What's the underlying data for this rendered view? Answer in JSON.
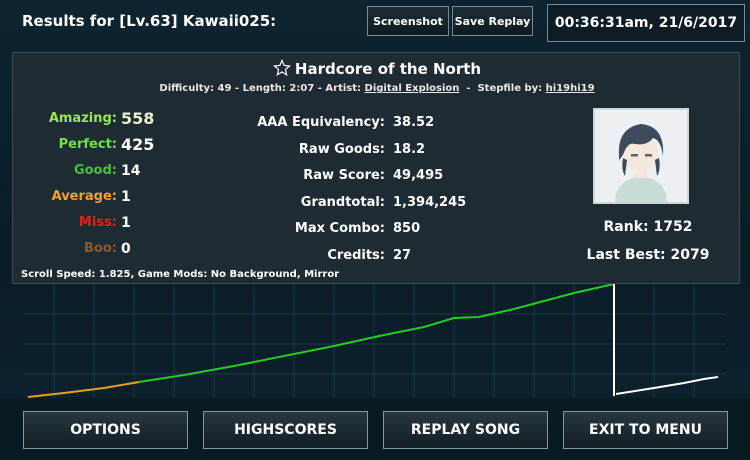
{
  "header": {
    "results_title": "Results for [Lv.63] Kawaii025:",
    "screenshot_label": "Screenshot",
    "save_replay_label": "Save Replay",
    "timestamp": "00:36:31am, 21/6/2017"
  },
  "song": {
    "title": "Hardcore of the North",
    "difficulty_label": "Difficulty:",
    "difficulty": "49",
    "length_label": "Length:",
    "length": "2:07",
    "artist_label": "Artist:",
    "artist": "Digital Explosion",
    "stepfile_label": "Stepfile by:",
    "stepfile_by": "hi19hi19"
  },
  "judgements": [
    {
      "label": "Amazing:",
      "value": "558",
      "color": "#9ae64e"
    },
    {
      "label": "Perfect:",
      "value": "425",
      "color": "#6ee04a"
    },
    {
      "label": "Good:",
      "value": "14",
      "color": "#45c236"
    },
    {
      "label": "Average:",
      "value": "1",
      "color": "#f0a12a"
    },
    {
      "label": "Miss:",
      "value": "1",
      "color": "#e8201c"
    },
    {
      "label": "Boo:",
      "value": "0",
      "color": "#8a5a2a"
    }
  ],
  "stats": [
    {
      "label": "AAA Equivalency:",
      "value": "38.52"
    },
    {
      "label": "Raw Goods:",
      "value": "18.2"
    },
    {
      "label": "Raw Score:",
      "value": "49,495"
    },
    {
      "label": "Grandtotal:",
      "value": "1,394,245"
    },
    {
      "label": "Max Combo:",
      "value": "850"
    },
    {
      "label": "Credits:",
      "value": "27"
    }
  ],
  "player": {
    "rank": "Rank: 1752",
    "last_best": "Last Best: 2079"
  },
  "mods": "Scroll Speed: 1.825, Game Mods: No Background, Mirror",
  "buttons": {
    "options": "OPTIONS",
    "highscores": "HIGHSCORES",
    "replay_song": "REPLAY SONG",
    "exit_to_menu": "EXIT TO MENU"
  },
  "icons": {
    "favorite": "star-outline-icon"
  },
  "colors": {
    "graph_green": "#22cc22",
    "graph_orange": "#e8a020",
    "graph_white": "#ffffff"
  }
}
